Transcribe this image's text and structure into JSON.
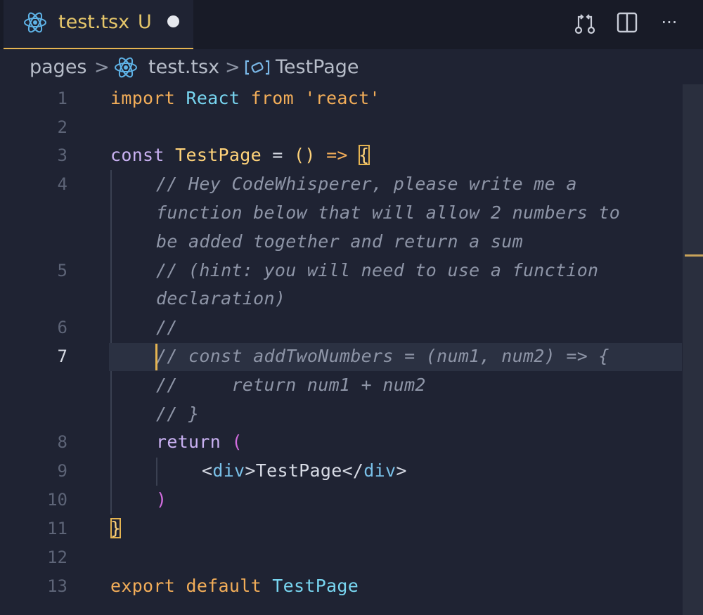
{
  "tab": {
    "filename": "test.tsx",
    "status": "U",
    "icon": "react-icon",
    "dirty": true
  },
  "toolbar": {
    "icons": [
      "compare-changes-icon",
      "split-editor-icon",
      "more-actions-icon"
    ],
    "more": "···"
  },
  "breadcrumb": {
    "items": [
      "pages",
      "test.tsx",
      "TestPage"
    ],
    "separator": ">",
    "icons": [
      "react-icon",
      "symbol-variable-icon"
    ]
  },
  "editor": {
    "active_line": 7,
    "line_numbers": [
      "1",
      "2",
      "3",
      "4",
      "5",
      "6",
      "7",
      "8",
      "9",
      "10",
      "11",
      "12",
      "13"
    ],
    "lines": {
      "l1": {
        "t1": "import",
        "t2": "React",
        "t3": "from",
        "t4": "'react'"
      },
      "l3": {
        "t1": "const",
        "t2": "TestPage",
        "t3": "=",
        "t4": "()",
        "t5": "=>",
        "t6": "{"
      },
      "l4a": "// Hey CodeWhisperer, please write me a",
      "l4b": "function below that will allow 2 numbers to",
      "l4c": "be added together and return a sum",
      "l5a": "// (hint: you will need to use a function",
      "l5b": "declaration)",
      "l6": "//",
      "l7": "// const addTwoNumbers = (num1, num2) => {",
      "l7b": "//     return num1 + num2",
      "l7c": "// }",
      "l8": {
        "t1": "return",
        "t2": "("
      },
      "l9": {
        "t1": "<",
        "t2": "div",
        "t3": ">TestPage</",
        "t4": "div",
        "t5": ">"
      },
      "l10": ")",
      "l11": "}",
      "l13": {
        "t1": "export",
        "t2": "default",
        "t3": "TestPage"
      }
    }
  },
  "colors": {
    "accent": "#e5b451",
    "background": "#1f2333",
    "keyword": "#f2ad59",
    "type": "#78d5f0",
    "comment": "#8e95a7"
  }
}
